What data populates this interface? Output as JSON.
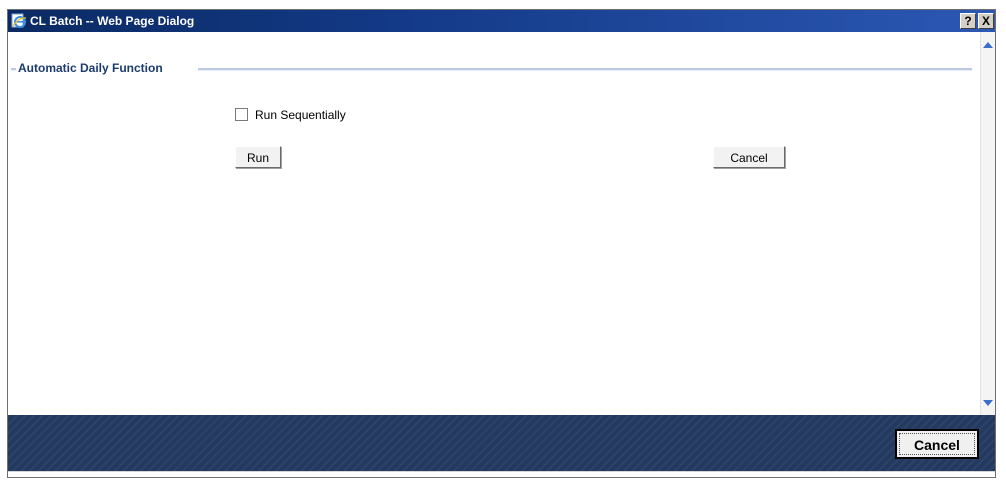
{
  "window": {
    "title": "CL Batch -- Web Page Dialog",
    "help_label": "?",
    "close_label": "X"
  },
  "section": {
    "legend": "Automatic Daily Function"
  },
  "options": {
    "run_sequentially_label": "Run Sequentially",
    "run_sequentially_checked": false
  },
  "buttons": {
    "run_label": "Run",
    "cancel_label": "Cancel"
  },
  "footer": {
    "cancel_label": "Cancel"
  },
  "colors": {
    "titlebar": "#133a87",
    "legend_text": "#1c3b70",
    "footer_bg": "#23395f",
    "scroll_arrow": "#3a6ec8"
  }
}
